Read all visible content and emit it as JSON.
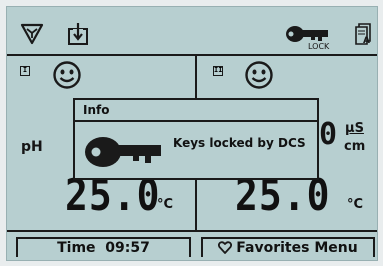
{
  "status_bar": {
    "funnel_icon": "funnel-icon",
    "download_icon": "download-icon",
    "lock_icon": "key-lock-icon",
    "lock_label": "LOCK",
    "doc_icon": "document-icon"
  },
  "channels": [
    {
      "badge": "I",
      "face_icon": "smiley-icon",
      "param_label": "pH",
      "temperature": "25.0",
      "temperature_unit": "°C"
    },
    {
      "badge": "II",
      "face_icon": "smiley-icon",
      "partial_value": "0",
      "unit_top": "µS",
      "unit_bottom": "cm",
      "temperature": "25.0",
      "temperature_unit": "°C"
    }
  ],
  "dialog": {
    "title": "Info",
    "message": "Keys locked by DCS",
    "icon": "key-icon"
  },
  "bottom_bar": {
    "time_button": "Time  09:57",
    "favorites_button": "Favorites Menu",
    "favorites_icon": "heart-icon"
  },
  "colors": {
    "screen_background": "#b7cfd0",
    "ink": "#111111"
  }
}
